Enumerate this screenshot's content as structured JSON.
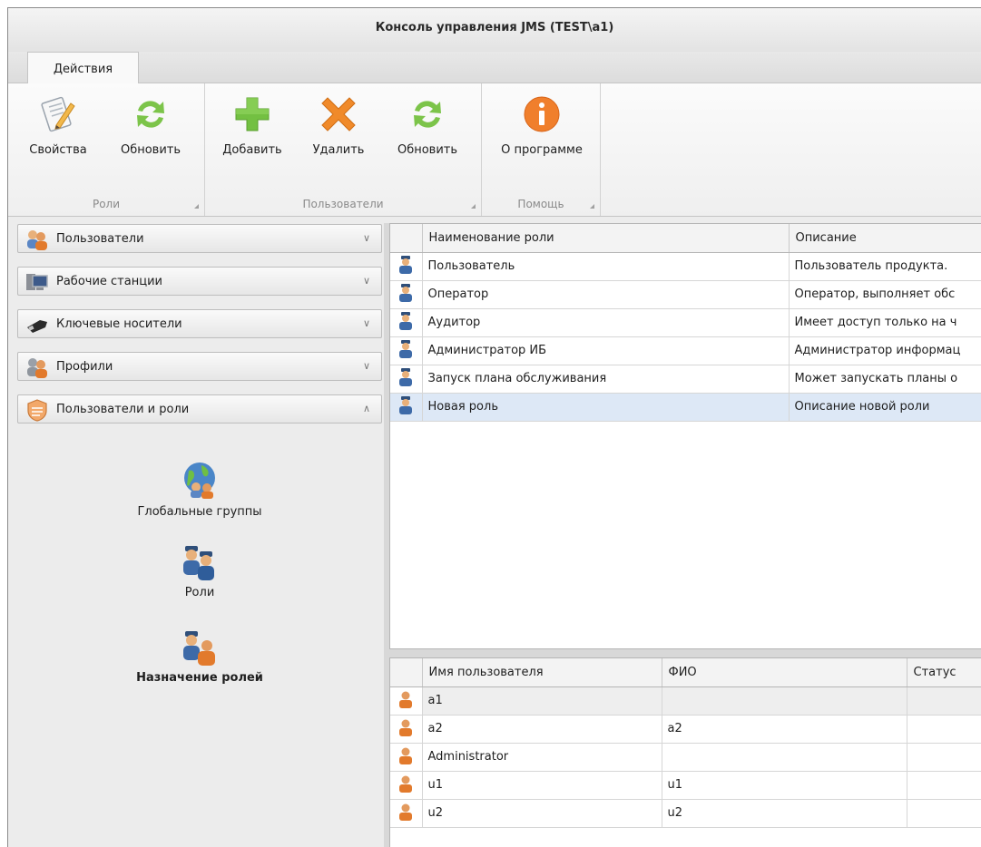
{
  "window": {
    "title": "Консоль управления JMS (TEST\\a1)"
  },
  "ribbon": {
    "tab": "Действия",
    "groups": [
      {
        "label": "Роли",
        "buttons": [
          {
            "label": "Свойства",
            "icon": "properties-icon"
          },
          {
            "label": "Обновить",
            "icon": "refresh-icon"
          }
        ]
      },
      {
        "label": "Пользователи",
        "buttons": [
          {
            "label": "Добавить",
            "icon": "add-icon"
          },
          {
            "label": "Удалить",
            "icon": "delete-icon"
          },
          {
            "label": "Обновить",
            "icon": "refresh-icon"
          }
        ]
      },
      {
        "label": "Помощь",
        "buttons": [
          {
            "label": "О программе",
            "icon": "info-icon"
          }
        ]
      }
    ]
  },
  "nav": {
    "sections": [
      {
        "label": "Пользователи",
        "icon": "users-icon",
        "chevron": "down"
      },
      {
        "label": "Рабочие станции",
        "icon": "workstations-icon",
        "chevron": "down"
      },
      {
        "label": "Ключевые носители",
        "icon": "key-carrier-icon",
        "chevron": "down"
      },
      {
        "label": "Профили",
        "icon": "profiles-icon",
        "chevron": "down"
      },
      {
        "label": "Пользователи и роли",
        "icon": "users-roles-icon",
        "chevron": "up"
      }
    ],
    "items": [
      {
        "label": "Глобальные группы",
        "icon": "global-groups-icon"
      },
      {
        "label": "Роли",
        "icon": "roles-icon"
      },
      {
        "label": "Назначение ролей",
        "icon": "role-assignment-icon",
        "active": true
      }
    ]
  },
  "roles_table": {
    "columns": [
      "Наименование роли",
      "Описание"
    ],
    "rows": [
      {
        "name": "Пользователь",
        "description": "Пользователь продукта."
      },
      {
        "name": "Оператор",
        "description": "Оператор, выполняет обс"
      },
      {
        "name": "Аудитор",
        "description": "Имеет доступ только на ч"
      },
      {
        "name": "Администратор ИБ",
        "description": "Администратор информац"
      },
      {
        "name": "Запуск плана обслуживания",
        "description": "Может запускать планы о"
      },
      {
        "name": "Новая роль",
        "description": "Описание новой роли",
        "selected": true
      }
    ]
  },
  "users_table": {
    "columns": [
      "Имя пользователя",
      "ФИО",
      "Статус"
    ],
    "rows": [
      {
        "username": "a1",
        "fio": "",
        "status": ""
      },
      {
        "username": "a2",
        "fio": "a2",
        "status": ""
      },
      {
        "username": "Administrator",
        "fio": "",
        "status": ""
      },
      {
        "username": "u1",
        "fio": "u1",
        "status": ""
      },
      {
        "username": "u2",
        "fio": "u2",
        "status": ""
      }
    ]
  }
}
